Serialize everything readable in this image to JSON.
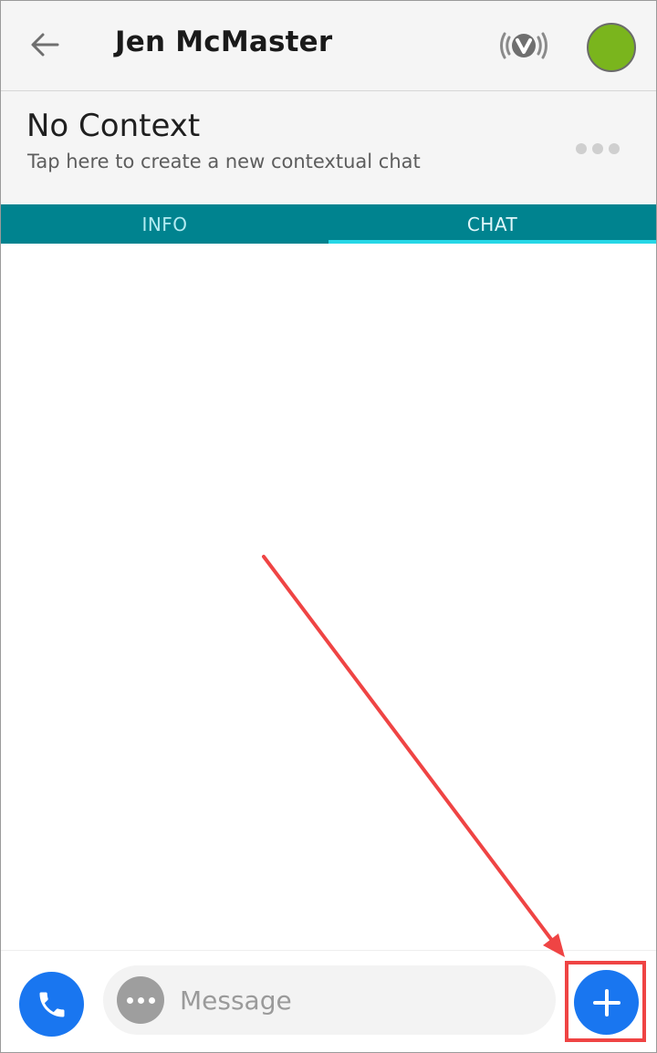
{
  "header": {
    "contact_name": "Jen McMaster",
    "back_icon": "arrow-left-icon",
    "brand_icon": "v-logo-icon",
    "presence_status_color": "#7ab51d"
  },
  "context": {
    "title": "No Context",
    "subtitle": "Tap here to create a new contextual chat",
    "more_icon": "more-horizontal-icon"
  },
  "tabs": [
    {
      "label": "INFO",
      "active": false
    },
    {
      "label": "CHAT",
      "active": true
    }
  ],
  "compose": {
    "placeholder": "Message",
    "value": "",
    "call_icon": "phone-icon",
    "more_icon": "more-horizontal-icon",
    "add_icon": "plus-icon"
  },
  "colors": {
    "accent": "#00838f",
    "tab_indicator": "#26d7e6",
    "action_blue": "#1976f0",
    "annotation_red": "#ef4444"
  }
}
